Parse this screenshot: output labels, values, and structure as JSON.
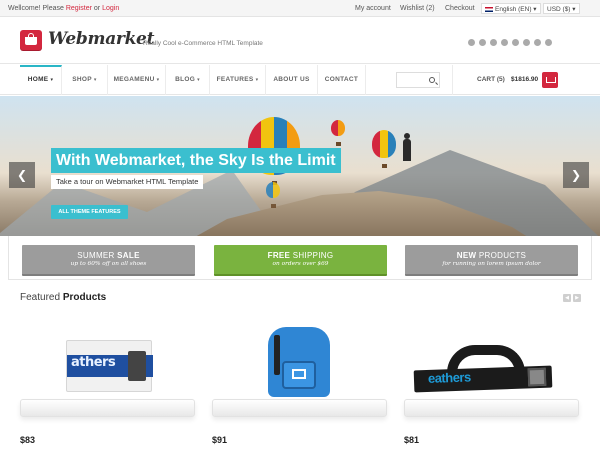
{
  "topbar": {
    "welcome_prefix": "Wellcome! Please",
    "register": "Register",
    "or": "or",
    "login": "Login",
    "links": [
      "My account",
      "Wishlist (2)",
      "Checkout"
    ],
    "language": "English (EN)",
    "currency": "USD ($)"
  },
  "header": {
    "logo": "Webmarket",
    "tagline": "Really Cool e-Commerce HTML Template",
    "social_icons": [
      "facebook-icon",
      "skype-icon",
      "twitter-icon",
      "rss-icon",
      "wordpress-icon",
      "android-icon",
      "apple-icon",
      "windows-icon"
    ]
  },
  "nav": {
    "items": [
      "HOME",
      "SHOP",
      "MEGAMENU",
      "BLOG",
      "FEATURES",
      "ABOUT US",
      "CONTACT"
    ],
    "cart_label": "CART (5)",
    "cart_total": "$1816.90"
  },
  "hero": {
    "title": "With Webmarket, the Sky Is the Limit",
    "subtitle": "Take a tour on Webmarket HTML Template",
    "button": "ALL THEME FEATURES"
  },
  "promos": [
    {
      "light": "SUMMER",
      "bold": "SALE",
      "sub": "up to 60% off on all shoes",
      "bold_first": false
    },
    {
      "light": "SHIPPING",
      "bold": "FREE",
      "sub": "on orders over $69",
      "bold_first": true
    },
    {
      "light": "PRODUCTS",
      "bold": "NEW",
      "sub": "for running on lorem ipsum dolor",
      "bold_first": true
    }
  ],
  "featured": {
    "title_light": "Featured",
    "title_bold": "Products",
    "products": [
      {
        "price": "$83",
        "label": "athers"
      },
      {
        "price": "$91",
        "label": ""
      },
      {
        "price": "$81",
        "label": "eathers"
      }
    ]
  },
  "colors": {
    "accent": "#d3273e",
    "teal": "#3bbfcf",
    "green": "#7ab33f",
    "gray": "#9c9c9c"
  }
}
